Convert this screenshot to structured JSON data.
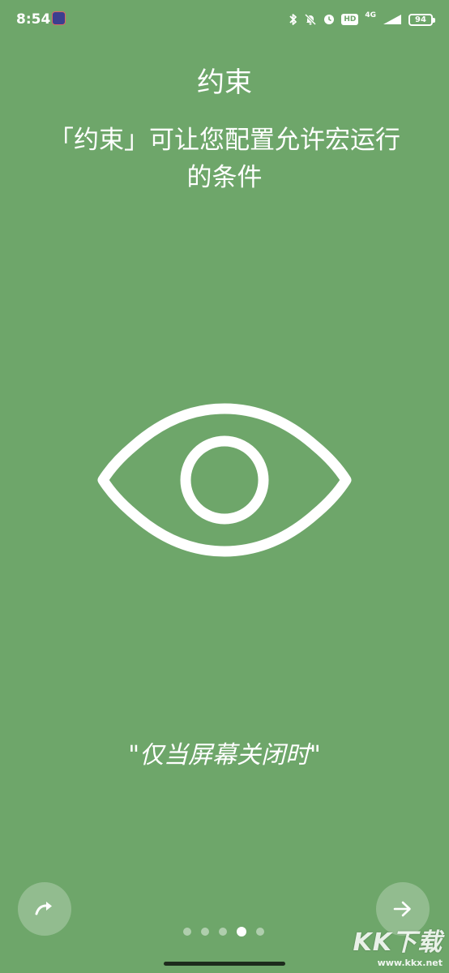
{
  "status_bar": {
    "time": "8:54",
    "network": "4G",
    "hd": "HD",
    "battery": "94",
    "icons": [
      "bluetooth-icon",
      "silent-bell-icon",
      "alarm-icon",
      "hd-icon",
      "signal-icon",
      "battery-icon"
    ]
  },
  "intro": {
    "title": "约束",
    "subtitle": "「约束」可让您配置允许宏运行的条件",
    "illustration": "eye-icon",
    "quote": "\"仅当屏幕关闭时\""
  },
  "pager": {
    "total": 5,
    "active_index": 3
  },
  "buttons": {
    "skip_icon": "redo-arrow-icon",
    "next_icon": "arrow-right-icon"
  },
  "watermark": {
    "text": "KK下载",
    "url": "www.kkx.net"
  },
  "colors": {
    "background": "#6ea66a",
    "foreground": "#ffffff"
  }
}
